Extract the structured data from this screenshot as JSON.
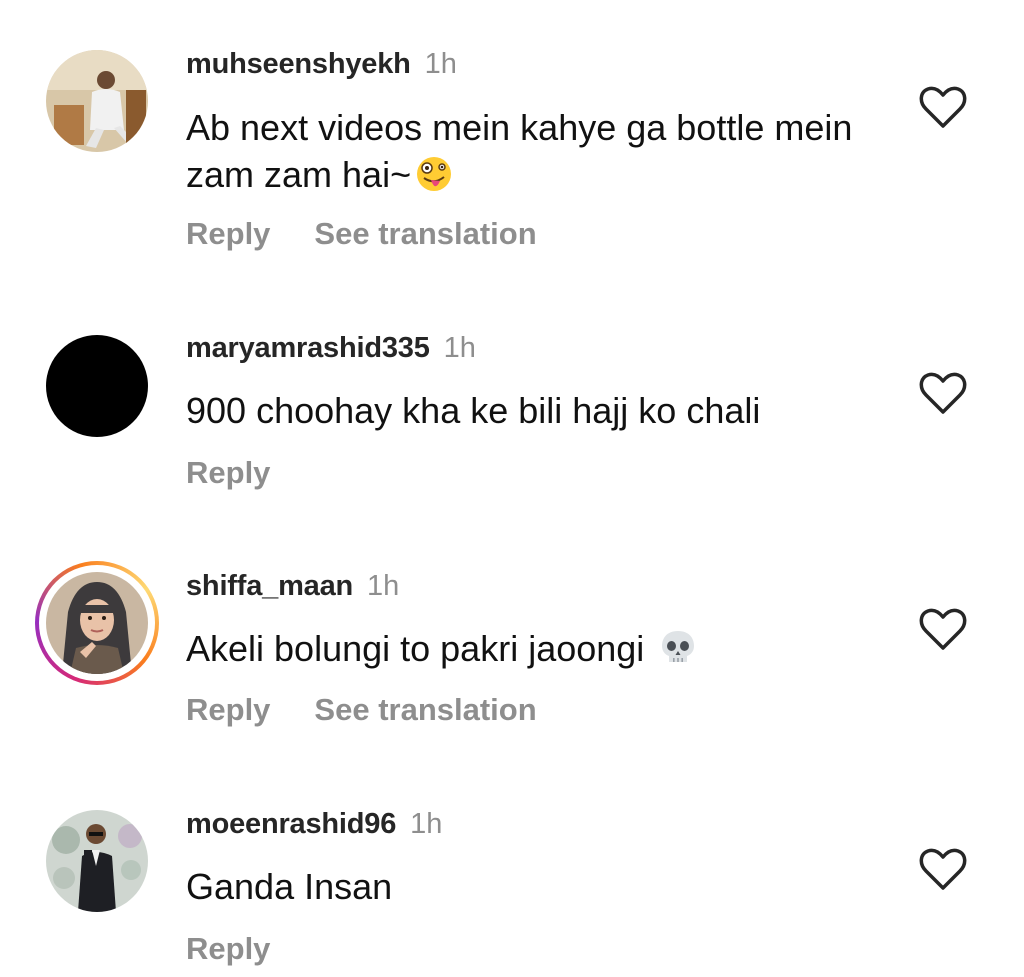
{
  "comments": [
    {
      "username": "muhseenshyekh",
      "time": "1h",
      "text": "Ab next videos mein kahye ga bottle mein zam zam hai~",
      "emoji": "zany-face",
      "reply_label": "Reply",
      "translate_label": "See translation"
    },
    {
      "username": "maryamrashid335",
      "time": "1h",
      "text": "900 choohay kha ke bili hajj ko chali",
      "reply_label": "Reply"
    },
    {
      "username": "shiffa_maan",
      "time": "1h",
      "text": "Akeli bolungi to pakri jaoongi",
      "emoji": "skull",
      "reply_label": "Reply",
      "translate_label": "See translation"
    },
    {
      "username": "moeenrashid96",
      "time": "1h",
      "text": "Ganda Insan",
      "reply_label": "Reply"
    }
  ],
  "icons": {
    "like": "heart-outline-icon"
  },
  "colors": {
    "muted": "#8e8e8e",
    "text": "#111111",
    "story_ring": "#d62976"
  }
}
